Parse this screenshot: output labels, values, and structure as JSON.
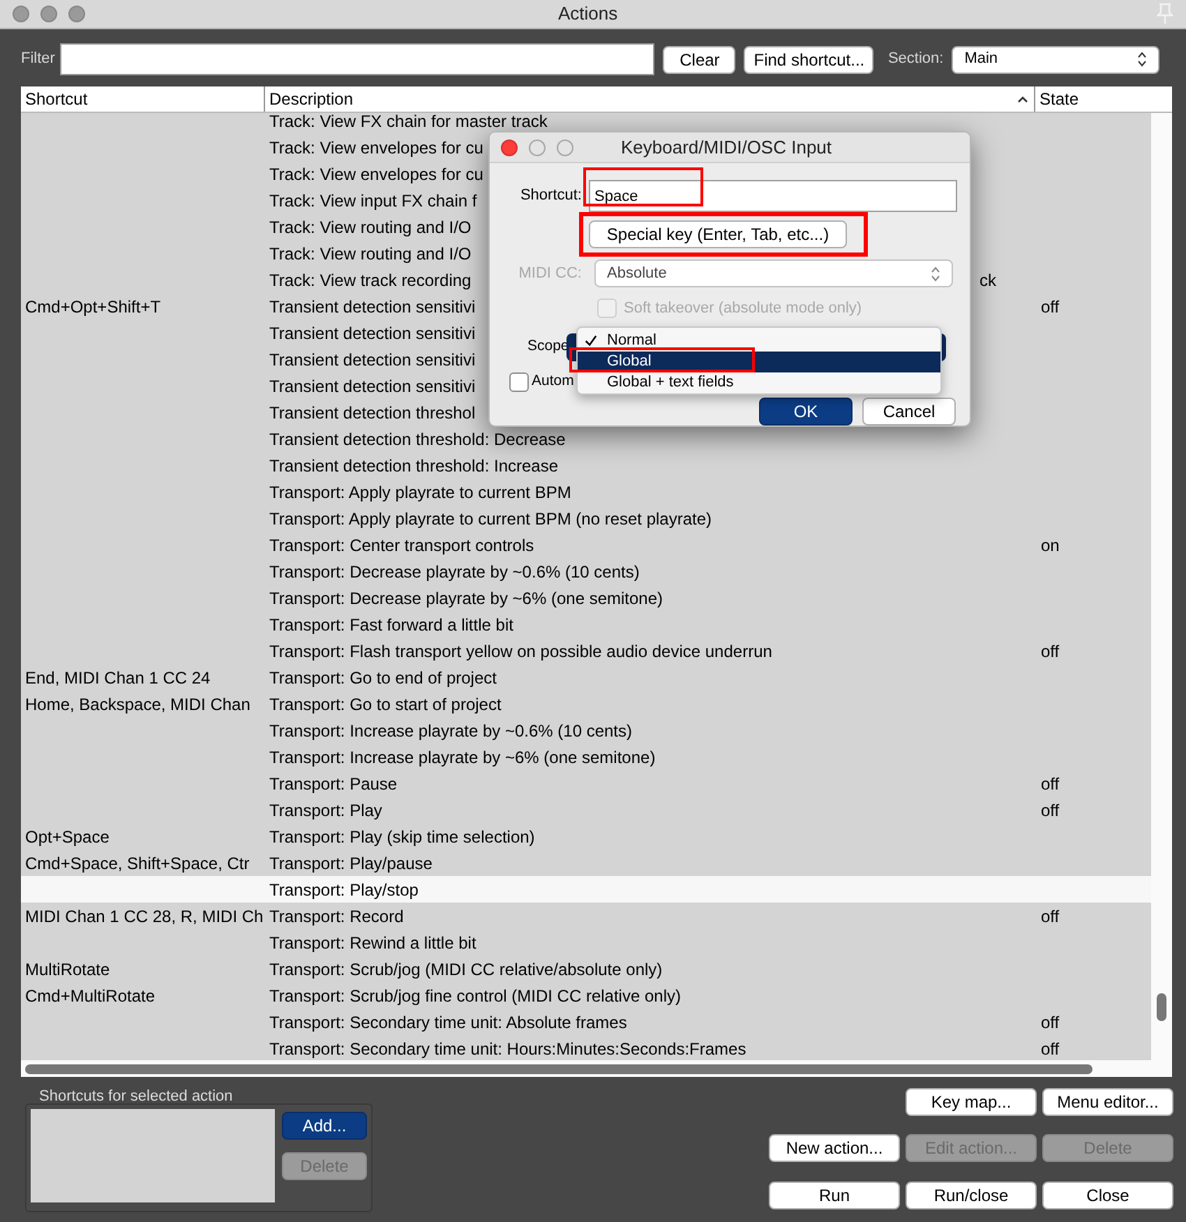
{
  "window": {
    "title": "Actions"
  },
  "filter": {
    "label": "Filter"
  },
  "filter_buttons": [
    "Clear",
    "Find shortcut..."
  ],
  "section": {
    "label": "Section:",
    "value": "Main"
  },
  "table": {
    "columns": [
      "Shortcut",
      "Description",
      "State"
    ],
    "rows": [
      {
        "description": "Track: View FX chain for master track",
        "selected": false
      },
      {
        "description": "Track: View envelopes for cu",
        "selected": false
      },
      {
        "description": "Track: View envelopes for cu",
        "selected": false
      },
      {
        "description": "Track: View input FX chain f",
        "selected": false
      },
      {
        "description": "Track: View routing and I/O",
        "selected": false
      },
      {
        "description": "Track: View routing and I/O",
        "selected": false
      },
      {
        "description": "Track: View track recording",
        "description_tail": "ck",
        "selected": false
      },
      {
        "shortcut": "Cmd+Opt+Shift+T",
        "description": "Transient detection sensitivi",
        "state": "off",
        "selected": false
      },
      {
        "description": "Transient detection sensitivi",
        "selected": false
      },
      {
        "description": "Transient detection sensitivi",
        "selected": false
      },
      {
        "description": "Transient detection sensitivi",
        "selected": false
      },
      {
        "description": "Transient detection threshol",
        "selected": false
      },
      {
        "description": "Transient detection threshold: Decrease",
        "selected": false
      },
      {
        "description": "Transient detection threshold: Increase",
        "selected": false
      },
      {
        "description": "Transport: Apply playrate to current BPM",
        "selected": false
      },
      {
        "description": "Transport: Apply playrate to current BPM (no reset playrate)",
        "selected": false
      },
      {
        "description": "Transport: Center transport controls",
        "state": "on",
        "selected": false
      },
      {
        "description": "Transport: Decrease playrate by ~0.6% (10 cents)",
        "selected": false
      },
      {
        "description": "Transport: Decrease playrate by ~6% (one semitone)",
        "selected": false
      },
      {
        "description": "Transport: Fast forward a little bit",
        "selected": false
      },
      {
        "description": "Transport: Flash transport yellow on possible audio device underrun",
        "state": "off",
        "selected": false
      },
      {
        "shortcut": "End, MIDI Chan 1 CC 24",
        "description": "Transport: Go to end of project",
        "selected": false
      },
      {
        "shortcut": "Home, Backspace, MIDI Chan",
        "description": "Transport: Go to start of project",
        "selected": false
      },
      {
        "description": "Transport: Increase playrate by ~0.6% (10 cents)",
        "selected": false
      },
      {
        "description": "Transport: Increase playrate by ~6% (one semitone)",
        "selected": false
      },
      {
        "description": "Transport: Pause",
        "state": "off",
        "selected": false
      },
      {
        "description": "Transport: Play",
        "state": "off",
        "selected": false
      },
      {
        "shortcut": "Opt+Space",
        "description": "Transport: Play (skip time selection)",
        "selected": false
      },
      {
        "shortcut": "Cmd+Space, Shift+Space, Ctr",
        "description": "Transport: Play/pause",
        "selected": false
      },
      {
        "description": "Transport: Play/stop",
        "selected": true
      },
      {
        "shortcut": "MIDI Chan 1 CC 28, R, MIDI Ch",
        "description": "Transport: Record",
        "state": "off",
        "selected": false
      },
      {
        "description": "Transport: Rewind a little bit",
        "selected": false
      },
      {
        "shortcut": "MultiRotate",
        "description": "Transport: Scrub/jog (MIDI CC relative/absolute only)",
        "selected": false
      },
      {
        "shortcut": "Cmd+MultiRotate",
        "description": "Transport: Scrub/jog fine control (MIDI CC relative only)",
        "selected": false
      },
      {
        "description": "Transport: Secondary time unit: Absolute frames",
        "state": "off",
        "selected": false
      },
      {
        "description": "Transport: Secondary time unit: Hours:Minutes:Seconds:Frames",
        "state": "off",
        "selected": false
      }
    ]
  },
  "shortcuts_group": {
    "label": "Shortcuts for selected action",
    "buttons": [
      {
        "label": "Add...",
        "default": true,
        "disabled": false
      },
      {
        "label": "Delete",
        "default": false,
        "disabled": true
      }
    ]
  },
  "action_buttons": [
    {
      "label": "Key map...",
      "disabled": false
    },
    {
      "label": "Menu editor...",
      "disabled": false
    },
    {
      "label": "New action...",
      "disabled": false
    },
    {
      "label": "Edit action...",
      "disabled": true
    },
    {
      "label": "Delete",
      "disabled": true
    },
    {
      "label": "Run",
      "disabled": false
    },
    {
      "label": "Run/close",
      "disabled": false
    },
    {
      "label": "Close",
      "disabled": false
    }
  ],
  "dialog": {
    "title": "Keyboard/MIDI/OSC Input",
    "shortcut": {
      "label": "Shortcut:",
      "value": "Space"
    },
    "special_key_button": "Special key (Enter, Tab, etc...)",
    "midi_cc": {
      "label": "MIDI CC:",
      "value": "Absolute",
      "disabled": true
    },
    "soft_takeover": {
      "label": "Soft takeover (absolute mode only)",
      "checked": false,
      "disabled": true
    },
    "scope": {
      "label": "Scope",
      "options": [
        {
          "label": "Normal",
          "checked": true,
          "selected": false
        },
        {
          "label": "Global",
          "checked": false,
          "selected": true
        },
        {
          "label": "Global + text fields",
          "checked": false,
          "selected": false
        }
      ]
    },
    "auto_checkbox": {
      "label": "Autom",
      "checked": false
    },
    "buttons": [
      {
        "label": "OK",
        "default": true
      },
      {
        "label": "Cancel",
        "default": false
      }
    ]
  }
}
